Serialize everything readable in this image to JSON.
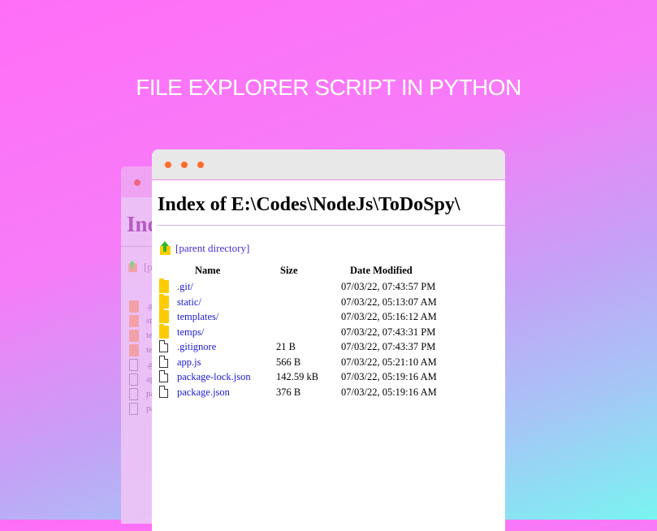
{
  "headline": "FILE EXPLORER SCRIPT IN PYTHON",
  "back_window": {
    "title": "Ind",
    "parent_link": "[p",
    "rows": [
      {
        "type": "folder",
        "name": ".g"
      },
      {
        "type": "folder",
        "name": "st"
      },
      {
        "type": "folder",
        "name": "te"
      },
      {
        "type": "folder",
        "name": "te"
      },
      {
        "type": "file",
        "name": ".g"
      },
      {
        "type": "file",
        "name": "ap"
      },
      {
        "type": "file",
        "name": "pa"
      },
      {
        "type": "file",
        "name": "pa"
      }
    ]
  },
  "window": {
    "page_title": "Index of E:\\Codes\\NodeJs\\ToDoSpy\\",
    "parent_link": "[parent directory]",
    "columns": {
      "name": "Name",
      "size": "Size",
      "date": "Date Modified"
    },
    "rows": [
      {
        "type": "folder",
        "name": ".git/",
        "size": "",
        "date": "07/03/22, 07:43:57 PM"
      },
      {
        "type": "folder",
        "name": "static/",
        "size": "",
        "date": "07/03/22, 05:13:07 AM"
      },
      {
        "type": "folder",
        "name": "templates/",
        "size": "",
        "date": "07/03/22, 05:16:12 AM"
      },
      {
        "type": "folder",
        "name": "temps/",
        "size": "",
        "date": "07/03/22, 07:43:31 PM"
      },
      {
        "type": "file",
        "name": ".gitignore",
        "size": "21 B",
        "date": "07/03/22, 07:43:37 PM"
      },
      {
        "type": "file",
        "name": "app.js",
        "size": "566 B",
        "date": "07/03/22, 05:21:10 AM"
      },
      {
        "type": "file",
        "name": "package-lock.json",
        "size": "142.59 kB",
        "date": "07/03/22, 05:19:16 AM"
      },
      {
        "type": "file",
        "name": "package.json",
        "size": "376 B",
        "date": "07/03/22, 05:19:16 AM"
      }
    ]
  },
  "colors": {
    "dot": "#ff6b2d",
    "folder": "#ffcc00",
    "link": "#1a1ad1"
  }
}
